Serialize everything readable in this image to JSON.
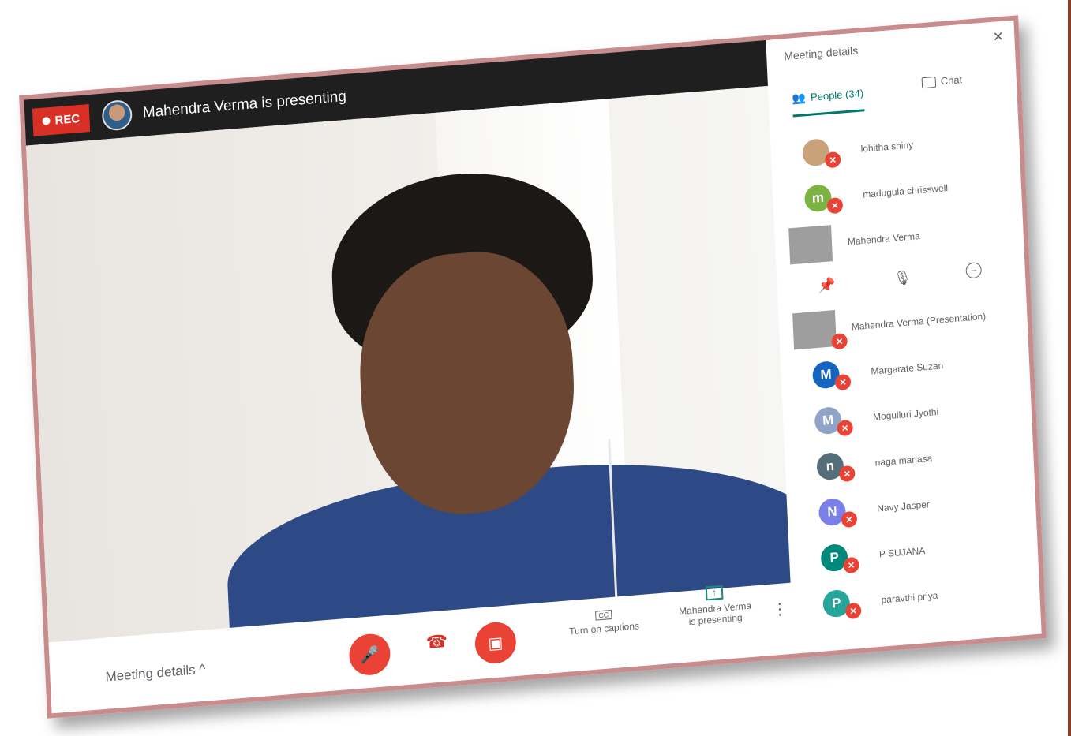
{
  "call": {
    "rec_label": "REC",
    "presenting_text": "Mahendra Verma is presenting"
  },
  "bottom": {
    "meeting_details": "Meeting details",
    "caret": "^",
    "captions_label": "Turn on captions",
    "presenting_line1": "Mahendra Verma",
    "presenting_line2": "is presenting"
  },
  "panel": {
    "title": "Meeting details",
    "tab_people": "People (34)",
    "tab_chat": "Chat",
    "participants": [
      {
        "name": "lohitha shiny",
        "initial": "",
        "color": "#c9a27a"
      },
      {
        "name": "madugula chrisswell",
        "initial": "m",
        "color": "#7cb342"
      },
      {
        "name": "Mahendra Verma",
        "initial": "",
        "color": "#9e9e9e"
      },
      {
        "name": "Mahendra Verma (Presentation)",
        "initial": "",
        "color": "#9e9e9e"
      },
      {
        "name": "Margarate Suzan",
        "initial": "M",
        "color": "#1565c0"
      },
      {
        "name": "Mogulluri Jyothi",
        "initial": "M",
        "color": "#90a4c8"
      },
      {
        "name": "naga manasa",
        "initial": "n",
        "color": "#546e7a"
      },
      {
        "name": "Navy Jasper",
        "initial": "N",
        "color": "#7b7fe8"
      },
      {
        "name": "P SUJANA",
        "initial": "P",
        "color": "#00897b"
      },
      {
        "name": "paravthi priya",
        "initial": "P",
        "color": "#26a69a"
      }
    ]
  },
  "icons": [
    "record-dot-icon",
    "mic-off-icon",
    "hangup-icon",
    "camera-off-icon",
    "captions-icon",
    "present-icon",
    "more-icon",
    "close-icon",
    "people-icon",
    "chat-icon",
    "pin-icon",
    "mic-icon",
    "remove-icon"
  ]
}
